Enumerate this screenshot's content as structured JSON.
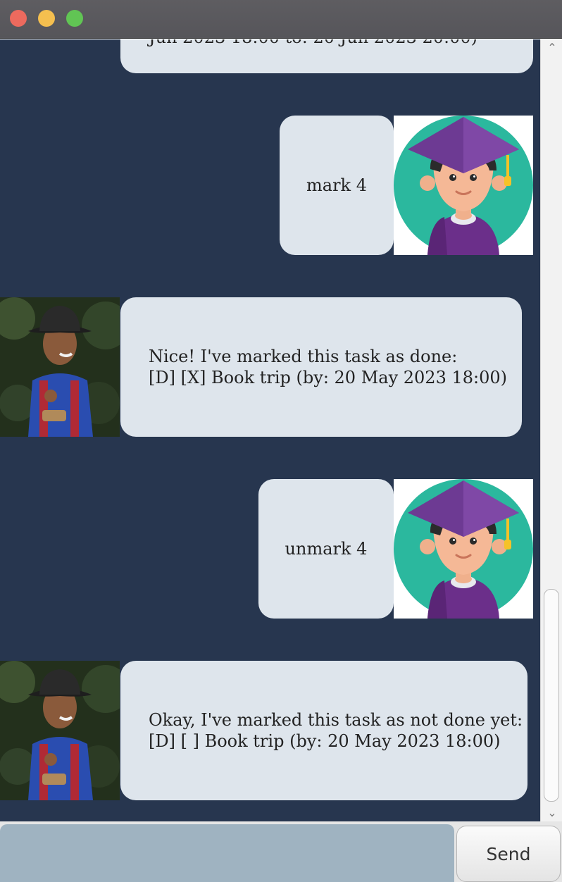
{
  "window": {
    "buttons": [
      "close",
      "minimize",
      "maximize"
    ]
  },
  "messages": [
    {
      "sender": "bot",
      "partial_text": "Jun 2023 18:00 to: 20 Jun 2023 20:00)"
    },
    {
      "sender": "user",
      "text": "mark 4"
    },
    {
      "sender": "bot",
      "lines": [
        "Nice! I've marked this task as done:",
        "[D] [X] Book trip (by: 20 May 2023 18:00)"
      ]
    },
    {
      "sender": "user",
      "text": "unmark 4"
    },
    {
      "sender": "bot",
      "lines": [
        "Okay, I've marked this task as not done yet:",
        "[D] [ ] Book trip (by: 20 May 2023 18:00)"
      ]
    }
  ],
  "input": {
    "value": "",
    "placeholder": ""
  },
  "send_button": {
    "label": "Send"
  },
  "icons": {
    "user_avatar": "graduate-student-avatar",
    "bot_avatar": "person-photo-avatar",
    "scroll_up": "chevron-up-icon",
    "scroll_down": "chevron-down-icon"
  },
  "colors": {
    "chat_background": "#27364f",
    "bubble": "#dee5ec",
    "input_background": "#9fb3c1"
  }
}
